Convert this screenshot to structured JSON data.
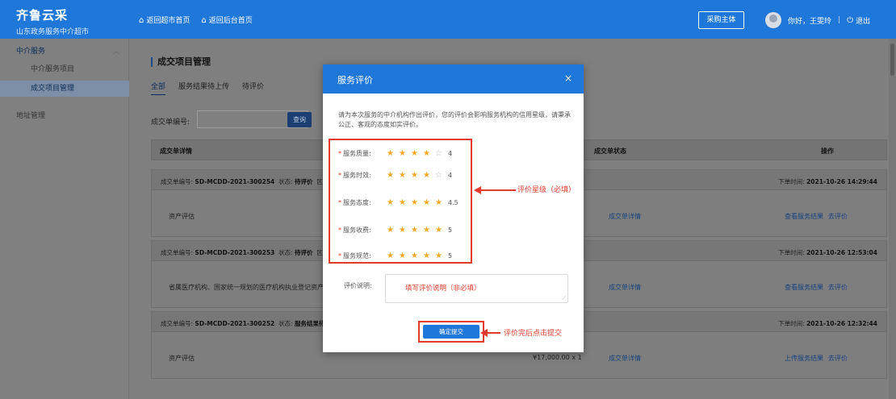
{
  "header": {
    "brand_title": "齐鲁云采",
    "brand_subtitle": "山东政务服务中介超市",
    "nav": [
      "返回超市首页",
      "返回后台首页"
    ],
    "buyer_button": "采购主体",
    "greeting": "你好，王雯玲",
    "logout": "退出"
  },
  "sidebar": {
    "group_label": "中介服务",
    "items": [
      "中介服务项目",
      "成交项目管理"
    ],
    "group2_label": "地址管理"
  },
  "page": {
    "title": "成交项目管理",
    "tabs": [
      "全部",
      "服务结果待上传",
      "待评价"
    ],
    "search_label": "成交单编号:",
    "search_button": "查询",
    "columns": [
      "成交单详情",
      "成交单状态",
      "操作"
    ]
  },
  "orders": [
    {
      "number_label": "成交单编号:",
      "number": "SD-MCDD-2021-300254",
      "status_label": "状态:",
      "status": "待评价",
      "region_label": "区划:",
      "time_label": "下单时间:",
      "time": "2021-10-26 14:29:44",
      "name": "资产评估",
      "price": "",
      "detail": "成交单详情",
      "ops": [
        "查看服务结果",
        "去评价"
      ]
    },
    {
      "number_label": "成交单编号:",
      "number": "SD-MCDD-2021-300253",
      "status_label": "状态:",
      "status": "待评价",
      "region_label": "区",
      "time_label": "下单时间:",
      "time": "2021-10-26 12:53:04",
      "name": "省属医疗机构、国家统一规划的医疗机构执业登记资产",
      "price": "",
      "detail": "成交单详情",
      "ops": [
        "查看服务结果",
        "去评价"
      ]
    },
    {
      "number_label": "成交单编号:",
      "number": "SD-MCDD-2021-300252",
      "status_label": "状态:",
      "status": "服务结果待上传",
      "region_label": "",
      "time_label": "下单时间:",
      "time": "2021-10-26 12:32:44",
      "name": "资产评估",
      "price": "¥17,000.00 x 1",
      "detail": "成交单详情",
      "ops": [
        "上传服务结果",
        "去评价"
      ]
    }
  ],
  "modal": {
    "title": "服务评价",
    "close": "×",
    "intro": "请为本次服务的中介机构作出评价，您的评价会影响服务机构的信用星级，请秉承公正、客观的态度如实评价。",
    "ratings": [
      {
        "label": "服务质量:",
        "value": 4
      },
      {
        "label": "服务时效:",
        "value": 4
      },
      {
        "label": "服务态度:",
        "value": 4.5
      },
      {
        "label": "服务收费:",
        "value": 5
      },
      {
        "label": "服务规范:",
        "value": 5
      }
    ],
    "required_mark": "*",
    "desc_label": "评价说明:",
    "desc_placeholder": "填写评价说明（非必填）",
    "submit": "确定提交"
  },
  "annotations": {
    "rating": "评价星级（必填）",
    "submit": "评价完后点击提交"
  },
  "colors": {
    "primary": "#1f77d9",
    "annotation": "#e23b2d",
    "star": "#f5a623"
  }
}
